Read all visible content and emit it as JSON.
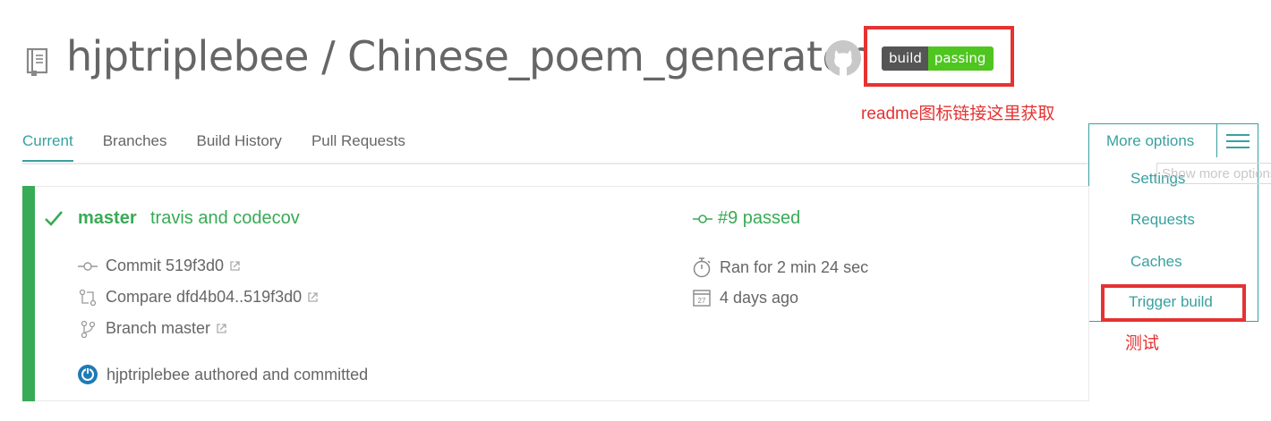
{
  "header": {
    "repo_title": "hjptriplebee / Chinese_poem_generator",
    "badge": {
      "left": "build",
      "right": "passing"
    },
    "annotation_badge": "readme图标链接这里获取"
  },
  "tabs": [
    {
      "label": "Current",
      "active": true
    },
    {
      "label": "Branches",
      "active": false
    },
    {
      "label": "Build History",
      "active": false
    },
    {
      "label": "Pull Requests",
      "active": false
    }
  ],
  "more_options": {
    "label": "More options",
    "tooltip": "Show more options",
    "items": [
      "Settings",
      "Requests",
      "Caches",
      "Trigger build"
    ],
    "annotation_trigger": "测试"
  },
  "build": {
    "branch": "master",
    "message": "travis and codecov",
    "number_status": "#9 passed",
    "commit": "Commit 519f3d0",
    "compare": "Compare dfd4b04..519f3d0",
    "branch_line": "Branch master",
    "duration": "Ran for 2 min 24 sec",
    "finished": "4 days ago",
    "author": "hjptriplebee authored and committed",
    "calendar_day": "27"
  },
  "colors": {
    "accent": "#39a0a0",
    "passed": "#39aa56",
    "annotation": "#e63232",
    "badge_left": "#555555",
    "badge_right": "#4fc51f"
  }
}
